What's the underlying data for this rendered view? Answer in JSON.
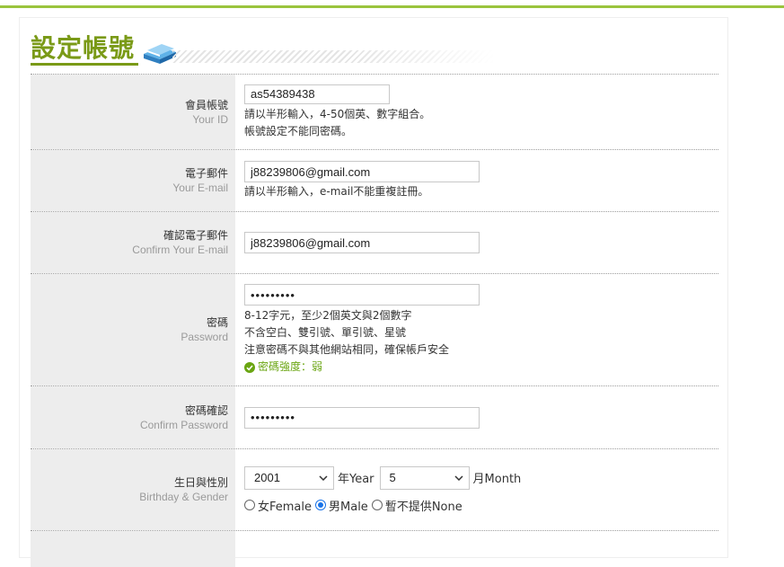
{
  "page": {
    "title": "設定帳號"
  },
  "form": {
    "user_id": {
      "label_zh": "會員帳號",
      "label_en": "Your ID",
      "value": "as54389438",
      "hints": [
        "請以半形輸入，4-50個英、數字組合。",
        "帳號設定不能同密碼。"
      ]
    },
    "email": {
      "label_zh": "電子郵件",
      "label_en": "Your E-mail",
      "value": "j88239806@gmail.com",
      "hints": [
        "請以半形輸入，e-mail不能重複註冊。"
      ]
    },
    "confirm_email": {
      "label_zh": "確認電子郵件",
      "label_en": "Confirm Your E-mail",
      "value": "j88239806@gmail.com"
    },
    "password": {
      "label_zh": "密碼",
      "label_en": "Password",
      "value": "•••••••••",
      "hints": [
        "8-12字元，至少2個英文與2個數字",
        "不含空白、雙引號、單引號、星號",
        "注意密碼不與其他網站相同，確保帳戶安全"
      ],
      "strength_text": "密碼強度：弱",
      "strength_color": "#6aa512"
    },
    "confirm_password": {
      "label_zh": "密碼確認",
      "label_en": "Confirm Password",
      "value": "•••••••••"
    },
    "birthday_gender": {
      "label_zh": "生日與性別",
      "label_en": "Birthday & Gender",
      "year_value": "2001",
      "year_suffix": "年Year",
      "month_value": "5",
      "month_suffix": "月Month",
      "gender_options": [
        {
          "label": "女Female",
          "checked": false
        },
        {
          "label": "男Male",
          "checked": true
        },
        {
          "label": "暫不提供None",
          "checked": false
        }
      ]
    }
  },
  "colors": {
    "accent": "#7a9a17",
    "top_rule": "#9ac43d",
    "label_bg": "#ededed"
  }
}
